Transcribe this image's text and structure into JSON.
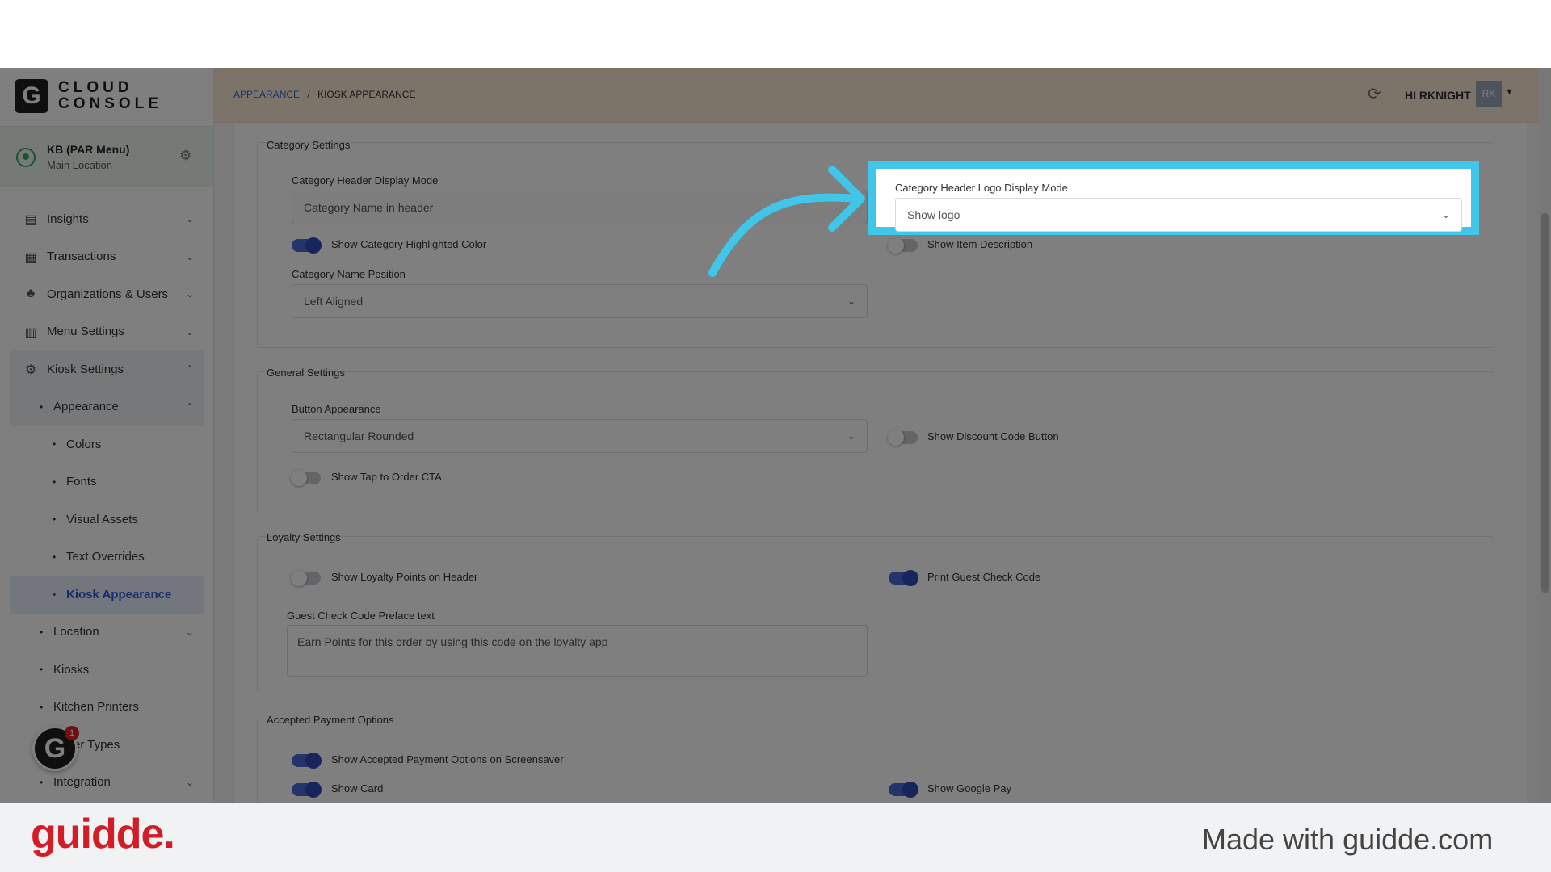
{
  "app": {
    "logo_letter": "G",
    "logo_line1": "CLOUD",
    "logo_line2": "CONSOLE"
  },
  "location": {
    "name": "KB (PAR Menu)",
    "subtitle": "Main Location"
  },
  "sidebar": {
    "items": [
      {
        "label": "Insights"
      },
      {
        "label": "Transactions"
      },
      {
        "label": "Organizations & Users"
      },
      {
        "label": "Menu Settings"
      },
      {
        "label": "Kiosk Settings"
      }
    ],
    "kiosk_sub": {
      "appearance": "Appearance",
      "appearance_children": [
        "Colors",
        "Fonts",
        "Visual Assets",
        "Text Overrides",
        "Kiosk Appearance"
      ],
      "others": [
        "Location",
        "Kiosks",
        "Kitchen Printers",
        "Order Types",
        "Integration"
      ]
    },
    "help_badge_letter": "G",
    "help_count": "1"
  },
  "header": {
    "breadcrumb_parent": "APPEARANCE",
    "breadcrumb_sep": "/",
    "breadcrumb_current": "KIOSK APPEARANCE",
    "user": "HI RKNIGHT",
    "avatar": "RK"
  },
  "category_settings": {
    "title": "Category Settings",
    "header_display_mode_label": "Category Header Display Mode",
    "header_display_mode_value": "Category Name in header",
    "highlighted_color_label": "Show Category Highlighted Color",
    "name_position_label": "Category Name Position",
    "name_position_value": "Left Aligned",
    "logo_display_mode_label": "Category Header Logo Display Mode",
    "logo_display_mode_value": "Show logo",
    "item_description_label": "Show Item Description"
  },
  "general_settings": {
    "title": "General Settings",
    "button_appearance_label": "Button Appearance",
    "button_appearance_value": "Rectangular Rounded",
    "tap_to_order_label": "Show Tap to Order CTA",
    "discount_code_label": "Show Discount Code Button"
  },
  "loyalty_settings": {
    "title": "Loyalty Settings",
    "loyalty_points_label": "Show Loyalty Points on Header",
    "print_guest_label": "Print Guest Check Code",
    "preface_label": "Guest Check Code Preface text",
    "preface_value": "Earn Points for this order by using this code on the loyalty app"
  },
  "payment_options": {
    "title": "Accepted Payment Options",
    "screensaver_label": "Show Accepted Payment Options on Screensaver",
    "card_label": "Show Card",
    "google_pay_label": "Show Google Pay"
  },
  "toggles": {
    "highlighted_color": true,
    "item_description": false,
    "tap_to_order": false,
    "discount_code": false,
    "loyalty_points": false,
    "print_guest": true,
    "screensaver": true,
    "card": true,
    "google_pay": true
  },
  "footer": {
    "brand": "guidde.",
    "made_with": "Made with guidde.com"
  },
  "colors": {
    "highlight": "#3fc6e8",
    "brand_red": "#d31d26",
    "toggle_on": "#4d68d8",
    "header_bg": "#fbe9d2"
  }
}
